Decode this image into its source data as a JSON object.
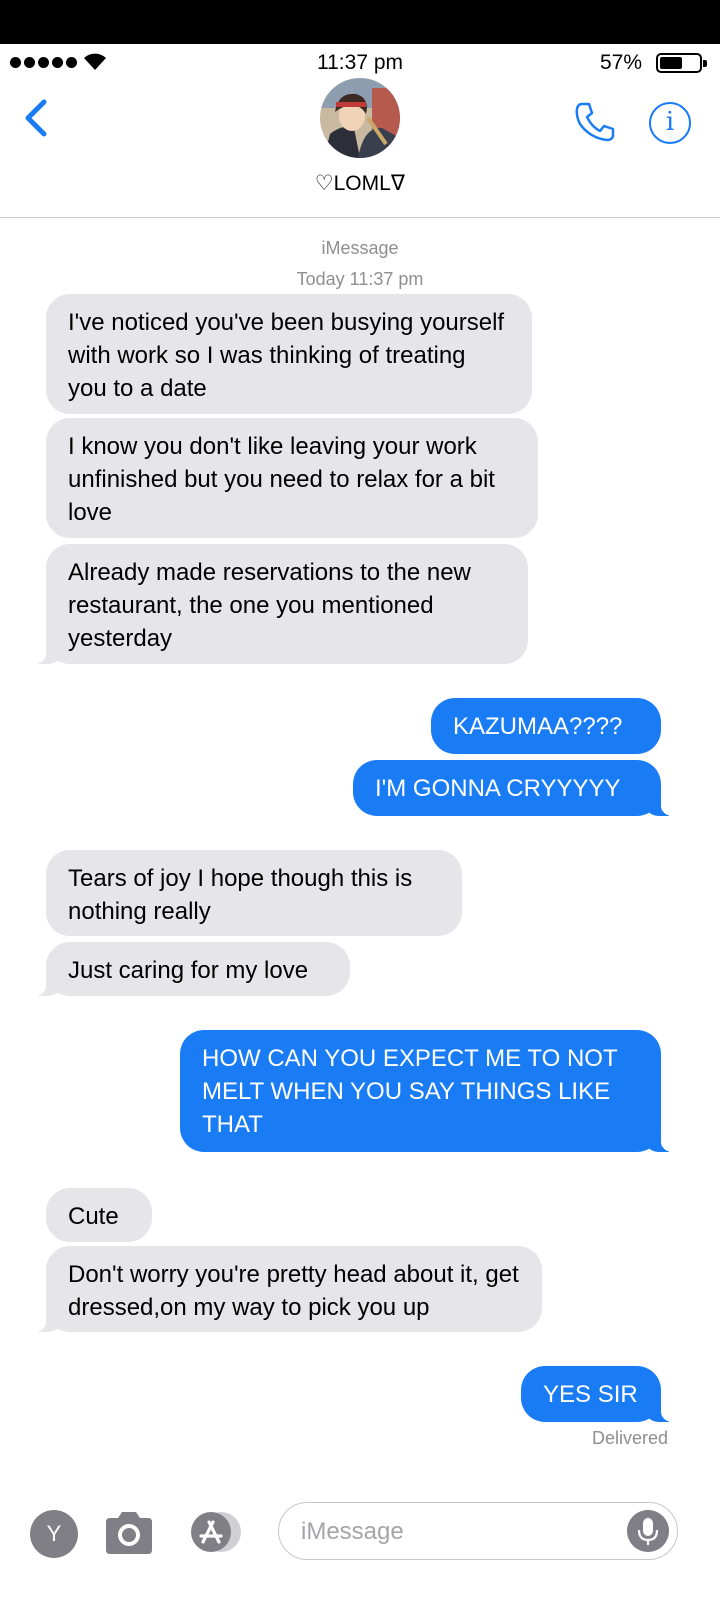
{
  "status_bar": {
    "time": "11:37 pm",
    "battery_percent": "57%",
    "battery_level": 0.57,
    "signal_bars": 5
  },
  "header": {
    "contact_name": "♡LOMLᐁ",
    "back_icon": "chevron-left-icon",
    "call_icon": "phone-icon",
    "info_icon": "info-icon",
    "info_glyph": "i",
    "accent_color": "#1a7cf5"
  },
  "thread": {
    "service": "iMessage",
    "date": "Today 11:37 pm",
    "messages": [
      {
        "from": "them",
        "text": "I've noticed you've been busying yourself with work so I was thinking of treating you to a date"
      },
      {
        "from": "them",
        "text": "I know you don't like leaving your work unfinished but you need to relax for a bit love"
      },
      {
        "from": "them",
        "text": "Already made reservations to the new restaurant, the one you mentioned yesterday"
      },
      {
        "from": "me",
        "text": "KAZUMAA????"
      },
      {
        "from": "me",
        "text": "I'M GONNA CRYYYYY"
      },
      {
        "from": "them",
        "text": "Tears of joy I hope though this is nothing really"
      },
      {
        "from": "them",
        "text": "Just caring for my love"
      },
      {
        "from": "me",
        "text": "HOW CAN YOU EXPECT ME TO NOT MELT WHEN YOU SAY THINGS LIKE THAT"
      },
      {
        "from": "them",
        "text": "Cute"
      },
      {
        "from": "them",
        "text": "Don't worry you're pretty head about it, get dressed,on my way to pick you up"
      },
      {
        "from": "me",
        "text": "YES SIR"
      }
    ],
    "delivery_status": "Delivered",
    "colors": {
      "sent": "#1a7cf5",
      "received": "#e5e5ea"
    }
  },
  "composer": {
    "app_button_label": "Y",
    "placeholder": "iMessage",
    "camera_icon": "camera-icon",
    "apps_icon": "app-store-icon",
    "mic_icon": "microphone-icon"
  }
}
